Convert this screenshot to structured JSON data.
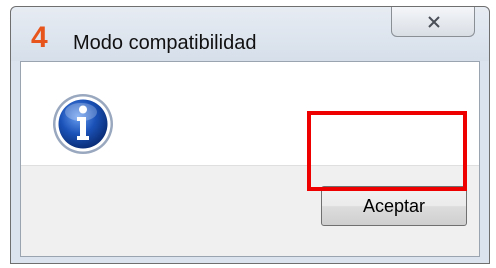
{
  "window": {
    "logo_text": "4",
    "title": "Modo compatibilidad"
  },
  "dialog": {
    "icon": "info-icon",
    "ok_label": "Aceptar"
  },
  "colors": {
    "logo": "#e8551c",
    "highlight": "#ee0000",
    "info_icon": "#1b52b8"
  }
}
